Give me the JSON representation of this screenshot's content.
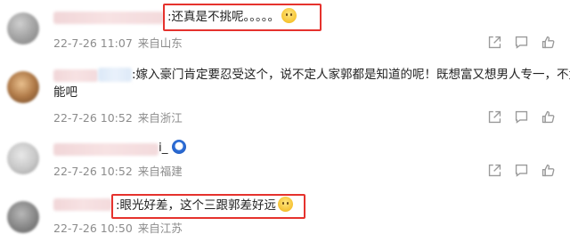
{
  "comments": [
    {
      "text": ":还真是不挑呢。。。。。",
      "date": "22-7-26 11:07",
      "location": "来自山东",
      "icons": [
        "share-icon",
        "comment-icon",
        "like-icon"
      ]
    },
    {
      "text_line1": ":嫁入豪门肯定要忍受这个，说不定人家郭都是知道的呢！既想富又想男人专一，不太可",
      "text_line2": "能吧",
      "date": "22-7-26 10:52",
      "location": "来自浙江"
    },
    {
      "text": "i_",
      "date": "22-7-26 10:52",
      "location": "来自福建"
    },
    {
      "text": ":眼光好差，这个三跟郭差好远",
      "date": "22-7-26 10:50",
      "location": "来自江苏"
    }
  ],
  "colors": {
    "highlight_box": "#e5322d",
    "meta_text": "#8c8c8c",
    "icon": "#9a9a9a"
  }
}
